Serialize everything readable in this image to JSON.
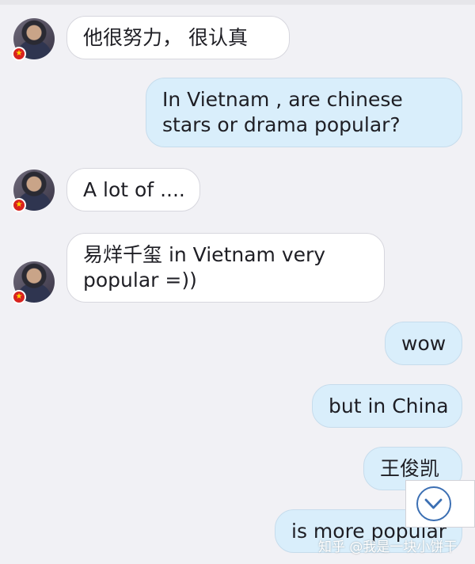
{
  "messages": [
    {
      "side": "in",
      "lines": [
        "他很努力， 很认真"
      ]
    },
    {
      "side": "out",
      "lines": [
        "In Vietnam , are chinese",
        "stars or drama  popular?"
      ]
    },
    {
      "side": "in",
      "lines": [
        "A lot of ...."
      ]
    },
    {
      "side": "in",
      "lines": [
        "易烊千玺 in Vietnam very",
        "popular =))"
      ]
    },
    {
      "side": "out",
      "lines": [
        "wow"
      ]
    },
    {
      "side": "out",
      "lines": [
        "but in China"
      ]
    },
    {
      "side": "out",
      "lines": [
        "王俊凯"
      ]
    },
    {
      "side": "out",
      "lines": [
        "is more popular"
      ]
    }
  ],
  "avatar_badge_icon": "vietnam-flag-star",
  "watermark": "知乎 @我是一块小饼干"
}
